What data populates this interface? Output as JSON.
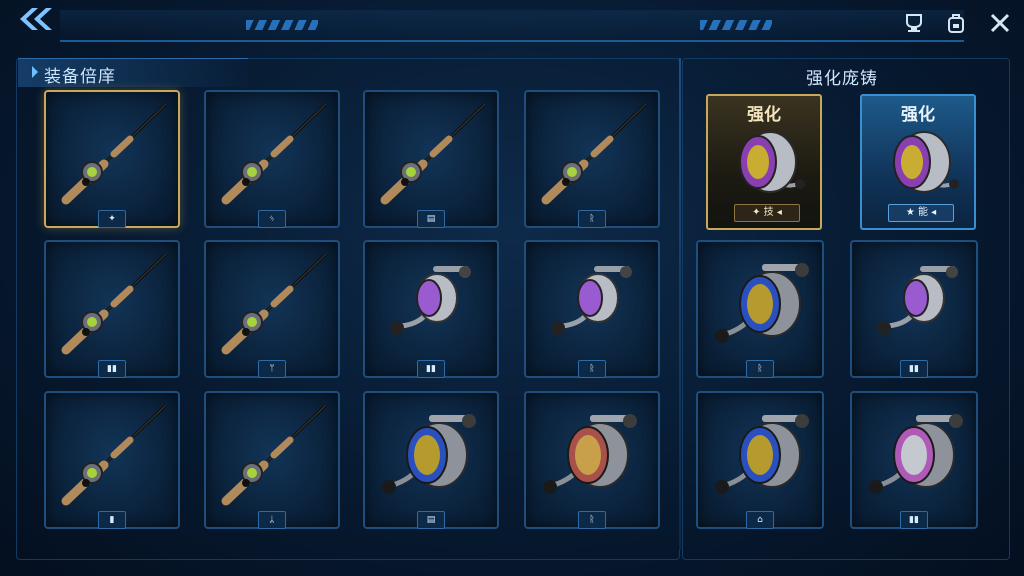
{
  "header": {
    "back_icon": "double-chevron-left-icon",
    "right_icons": [
      "trophy-cup-icon",
      "backpack-icon",
      "close-icon"
    ]
  },
  "panels": {
    "left_title": "装备倍庠",
    "right_title": "强化庞铸"
  },
  "accent_colors": {
    "selected": "#c9a85a",
    "frame": "#1d4e7e",
    "highlight": "#3a8fd0"
  },
  "equipment": [
    {
      "item": "fishing-rod",
      "tag": "✦",
      "selected": true
    },
    {
      "item": "fishing-rod",
      "tag": "ᛃ"
    },
    {
      "item": "fishing-rod",
      "tag": "▤"
    },
    {
      "item": "fishing-rod",
      "tag": "ᚱ"
    },
    {
      "item": "fishing-rod",
      "tag": "▮▮"
    },
    {
      "item": "fishing-rod",
      "tag": "ᛘ"
    },
    {
      "item": "spinning-reel",
      "tag": "▮▮"
    },
    {
      "item": "spinning-reel",
      "tag": "ᚱ"
    },
    {
      "item": "fishing-rod",
      "tag": "▮"
    },
    {
      "item": "fishing-rod",
      "tag": "ᛦ"
    },
    {
      "item": "large-reel-blue",
      "tag": "▤"
    },
    {
      "item": "large-reel-red",
      "tag": "ᚱ"
    }
  ],
  "enhance": {
    "featured": [
      {
        "label": "强化",
        "plate": "✦ 技 ◂",
        "style": "gold"
      },
      {
        "label": "强化",
        "plate": "★ 能 ◂",
        "style": "blue"
      }
    ],
    "items": [
      {
        "item": "large-reel-blue",
        "tag": "ᚱ"
      },
      {
        "item": "spinning-reel",
        "tag": "▮▮"
      },
      {
        "item": "large-reel-blue",
        "tag": "⌂"
      },
      {
        "item": "large-reel-silver",
        "tag": "▮▮"
      }
    ]
  }
}
